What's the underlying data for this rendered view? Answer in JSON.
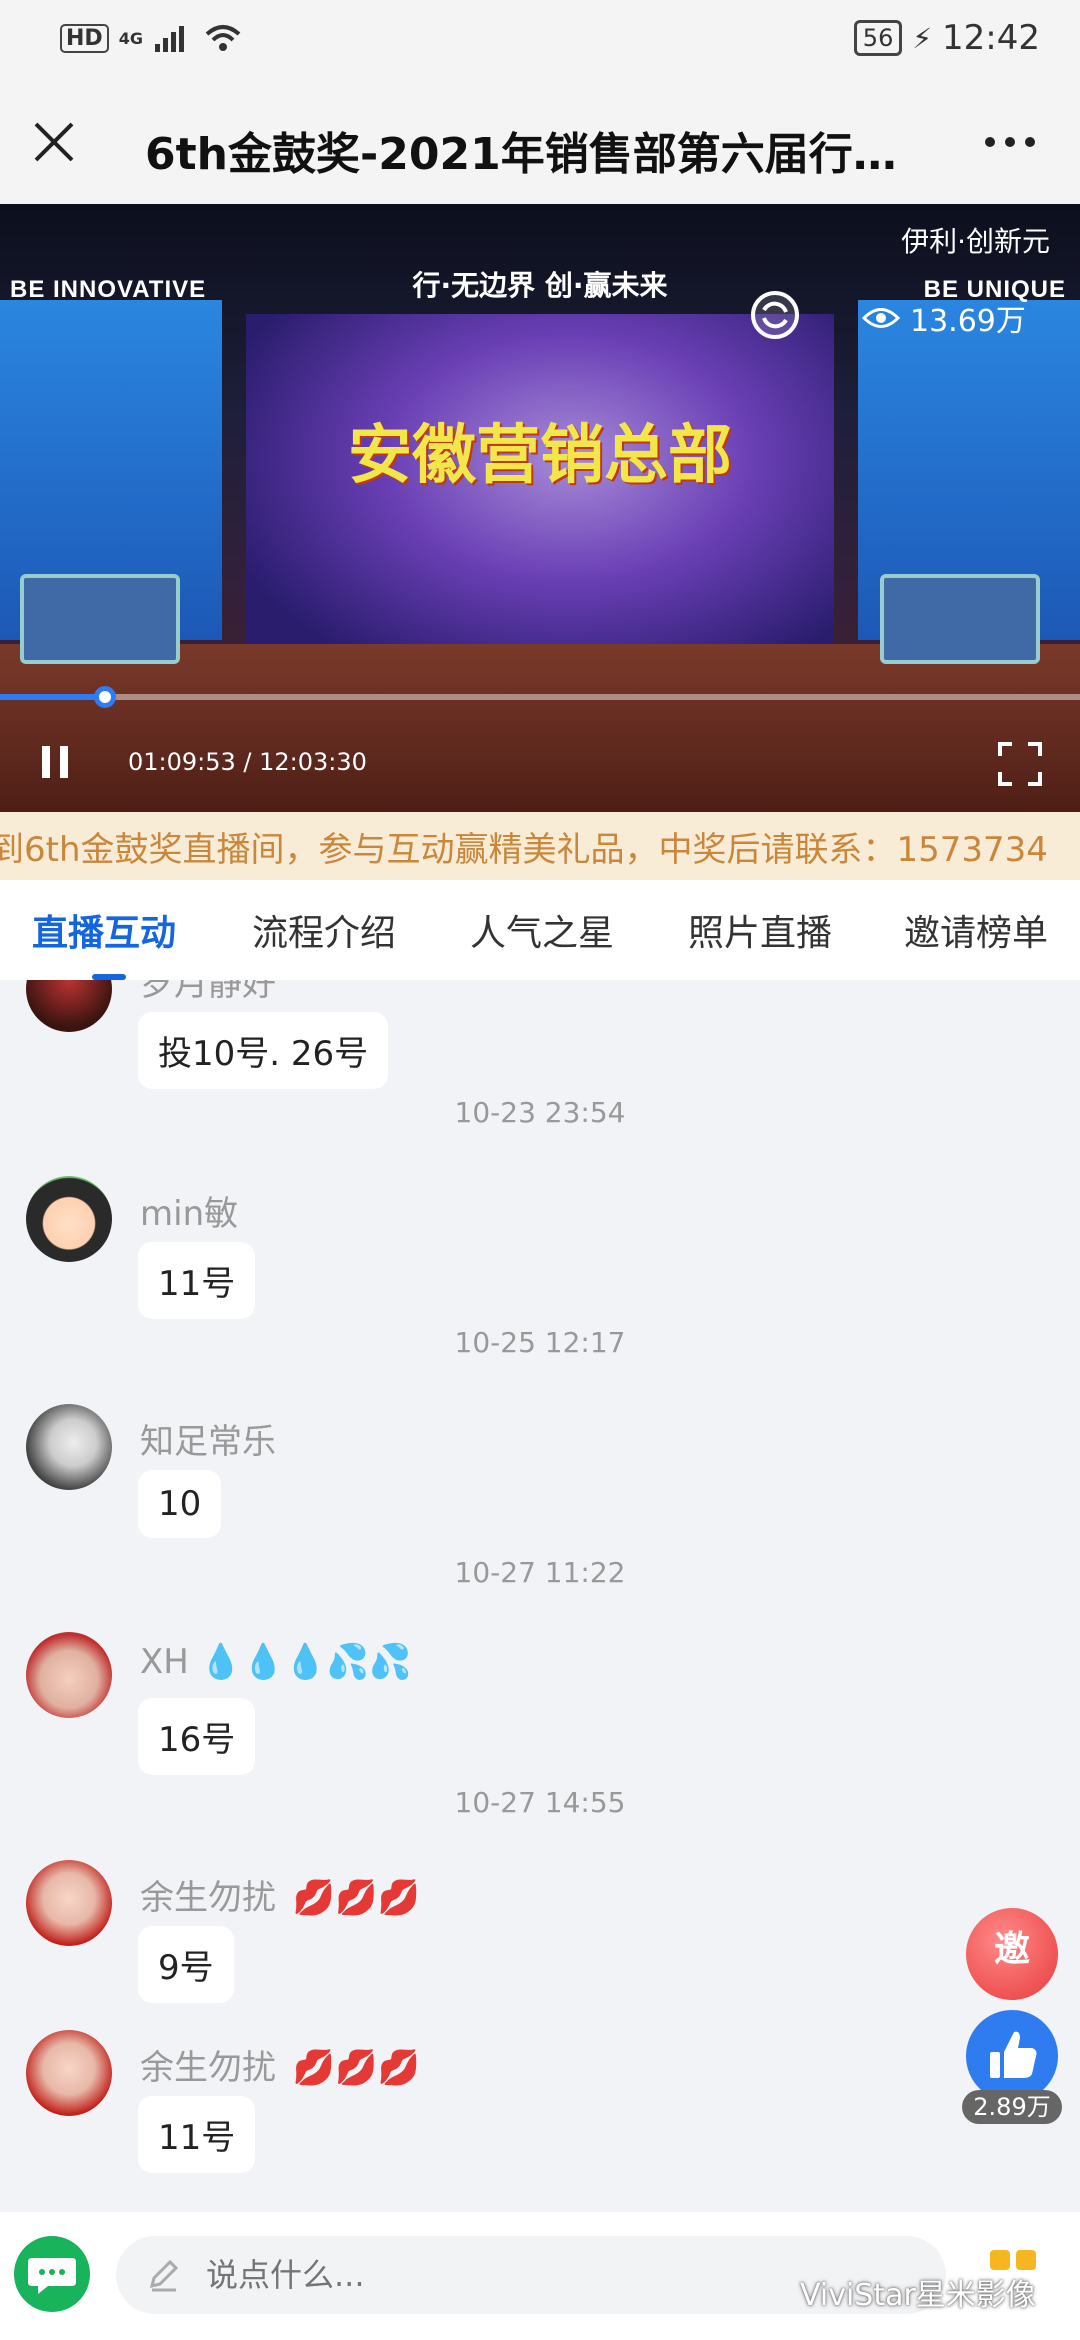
{
  "status_bar": {
    "hd": "HD",
    "network": "4G",
    "battery": "56",
    "time": "12:42"
  },
  "header": {
    "title": "6th金鼓奖-2021年销售部第六届行销...",
    "close_icon": "close-icon",
    "more_icon": "more-icon"
  },
  "video": {
    "brand_tag": "伊利·创新元",
    "view_count": "13.69万",
    "time_display": "01:09:53 / 12:03:30",
    "progress": 0.097,
    "stage_left_heading": "BE INNOVATIVE",
    "stage_right_heading": "BE UNIQUE",
    "stage_slogan": "行·无边界  创·赢未来",
    "stage_caption": "安徽营销总部"
  },
  "ticker": {
    "text": "到6th金鼓奖直播间，参与互动赢精美礼品，中奖后请联系：1573734"
  },
  "tabs": [
    {
      "label": "直播互动",
      "active": true
    },
    {
      "label": "流程介绍",
      "active": false
    },
    {
      "label": "人气之星",
      "active": false
    },
    {
      "label": "照片直播",
      "active": false
    },
    {
      "label": "邀请榜单",
      "active": false
    }
  ],
  "chat": {
    "messages": [
      {
        "nickname": "岁月静好",
        "text": "投10号. 26号",
        "emoji": ""
      },
      {
        "nickname": "min敏",
        "text": "11号",
        "emoji": ""
      },
      {
        "nickname": "知足常乐",
        "text": "10",
        "emoji": ""
      },
      {
        "nickname": "XH",
        "text": "16号",
        "emoji": "💧💧💧💦💦"
      },
      {
        "nickname": "余生勿扰",
        "text": "9号",
        "emoji": "💋💋💋"
      },
      {
        "nickname": "余生勿扰",
        "text": "11号",
        "emoji": "💋💋💋"
      }
    ],
    "timestamps": [
      "10-23 23:54",
      "10-25 12:17",
      "10-27 11:22",
      "10-27 14:55"
    ]
  },
  "fabs": {
    "invite_label": "邀",
    "like_count": "2.89万"
  },
  "bottom_bar": {
    "input_placeholder": "说点什么...",
    "watermark": "ViviStar星米影像"
  },
  "colors": {
    "accent": "#1366e0",
    "ticker_text": "#c9873b",
    "ticker_bg": "#f8ecd6",
    "green": "#19b35b"
  }
}
